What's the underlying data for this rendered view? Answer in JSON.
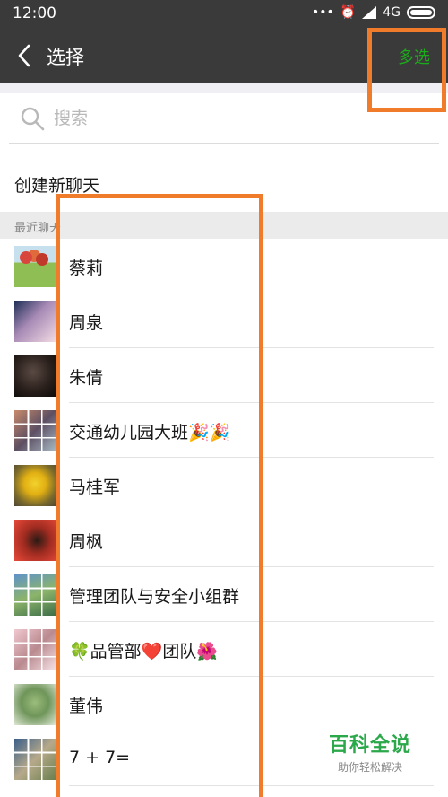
{
  "status_bar": {
    "time": "12:00",
    "icons": "••• ⏰ 📶 4G",
    "network": "4G"
  },
  "nav": {
    "title": "选择",
    "multi_select": "多选"
  },
  "search": {
    "placeholder": "搜索"
  },
  "create_chat": {
    "label": "创建新聊天"
  },
  "section": {
    "recent_label": "最近聊天"
  },
  "chats": [
    {
      "name": "蔡莉",
      "avatar": "av-tree"
    },
    {
      "name": "周泉",
      "avatar": "av-girl"
    },
    {
      "name": "朱倩",
      "avatar": "av-dark"
    },
    {
      "name": "交通幼儿园大班🎉🎉",
      "avatar": "av-grid"
    },
    {
      "name": "马桂军",
      "avatar": "av-flower"
    },
    {
      "name": "周枫",
      "avatar": "av-red"
    },
    {
      "name": "管理团队与安全小组群",
      "avatar": "av-grid2"
    },
    {
      "name": "🍀品管部❤️团队🌺",
      "avatar": "av-grid3"
    },
    {
      "name": "董伟",
      "avatar": "av-cartoon"
    },
    {
      "name": "7 + 7=",
      "avatar": "av-grid4"
    }
  ],
  "watermark": {
    "title": "百科全说",
    "subtitle": "助你轻松解决"
  },
  "colors": {
    "header_bg": "#3a3a3a",
    "accent_green": "#1aad19",
    "highlight_orange": "#f07b2a"
  }
}
